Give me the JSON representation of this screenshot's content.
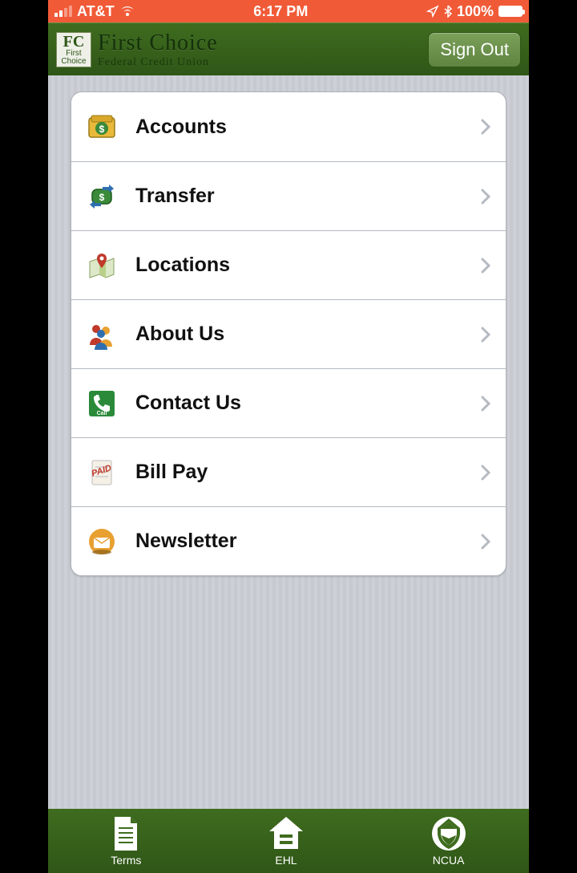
{
  "status": {
    "carrier": "AT&T",
    "time": "6:17 PM",
    "battery_text": "100%"
  },
  "header": {
    "brand_title": "First Choice",
    "brand_subtitle": "Federal Credit Union",
    "logo_initials": "FC",
    "logo_caption1": "First",
    "logo_caption2": "Choice",
    "signout_label": "Sign Out"
  },
  "menu": {
    "items": [
      {
        "label": "Accounts",
        "icon": "wallet-dollar-icon"
      },
      {
        "label": "Transfer",
        "icon": "transfer-arrows-icon"
      },
      {
        "label": "Locations",
        "icon": "map-pin-icon"
      },
      {
        "label": "About Us",
        "icon": "people-group-icon"
      },
      {
        "label": "Contact Us",
        "icon": "phone-call-icon"
      },
      {
        "label": "Bill Pay",
        "icon": "paid-receipt-icon"
      },
      {
        "label": "Newsletter",
        "icon": "email-envelope-icon"
      }
    ]
  },
  "footer": {
    "items": [
      {
        "label": "Terms",
        "icon": "document-icon"
      },
      {
        "label": "EHL",
        "icon": "equal-housing-icon"
      },
      {
        "label": "NCUA",
        "icon": "ncua-shield-icon"
      }
    ]
  }
}
